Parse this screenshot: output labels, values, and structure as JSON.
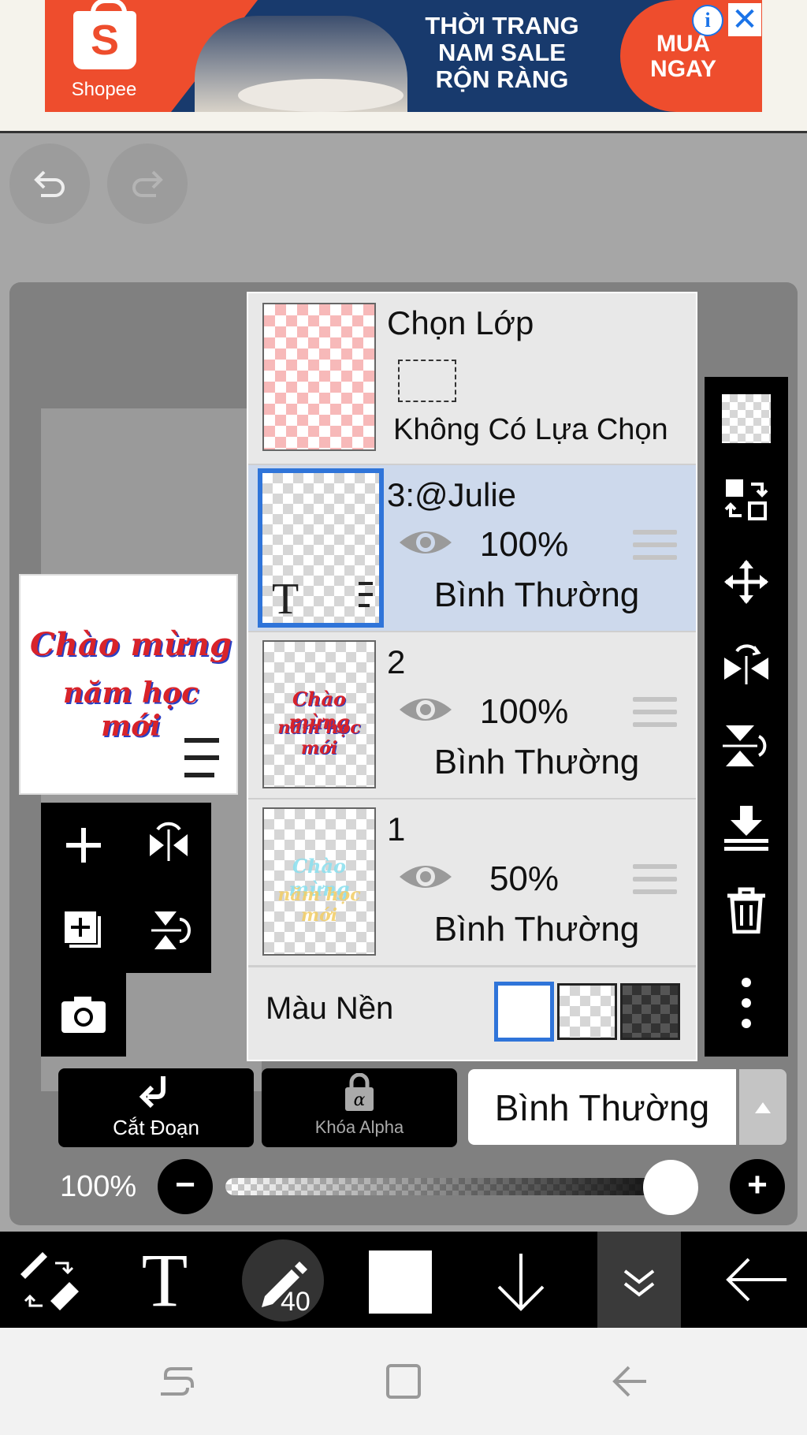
{
  "ad": {
    "brand": "Shopee",
    "headline": "THỜI TRANG\nNAM SALE\nRỘN RÀNG",
    "cta": "MUA\nNGAY",
    "info_icon": "info-icon",
    "close_icon": "close-icon"
  },
  "history": {
    "undo_icon": "undo-icon",
    "redo_icon": "redo-icon"
  },
  "preview": {
    "line1": "Chào mừng",
    "line2": "năm học mới"
  },
  "layers_panel": {
    "selection": {
      "title": "Chọn Lớp",
      "status": "Không Có Lựa Chọn"
    },
    "layers": [
      {
        "name": "3:@Julie",
        "opacity": "100%",
        "blend": "Bình Thường",
        "selected": true
      },
      {
        "name": "2",
        "opacity": "100%",
        "blend": "Bình Thường",
        "selected": false
      },
      {
        "name": "1",
        "opacity": "50%",
        "blend": "Bình Thường",
        "selected": false
      }
    ],
    "background": {
      "label": "Màu Nền",
      "options": [
        "white",
        "transparent",
        "dark"
      ],
      "selected": "white"
    }
  },
  "controls": {
    "clip_label": "Cắt Đoạn",
    "alpha_lock_label": "Khóa Alpha",
    "blend_mode": "Bình Thường",
    "opacity": "100%",
    "opacity_value": 1.0
  },
  "toolbar": {
    "brush_size": "40",
    "color": "#ffffff"
  },
  "colors": {
    "selected_layer_bg": "#cdd9ec",
    "accent_blue": "#2f74d9",
    "shopee_orange": "#ee4d2d"
  }
}
